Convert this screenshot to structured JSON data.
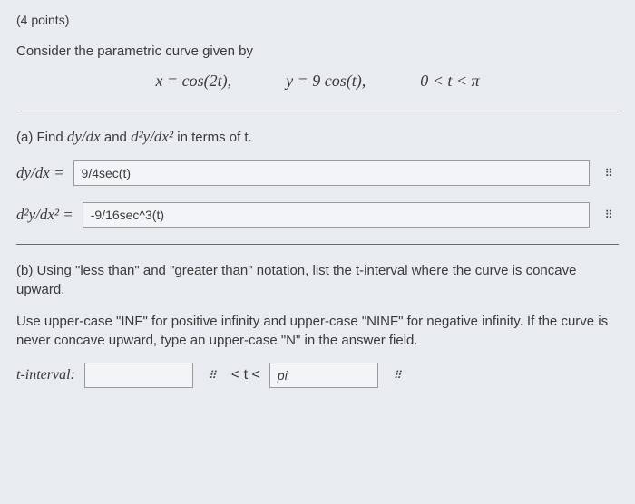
{
  "points": "(4 points)",
  "intro": "Consider the parametric curve given by",
  "eq": {
    "x": "x = cos(2t),",
    "y": "y = 9 cos(t),",
    "range": "0 < t < π"
  },
  "partA": {
    "prompt_prefix": "(a) Find ",
    "expr1": "dy/dx",
    "mid": " and ",
    "expr2": "d²y/dx²",
    "suffix": " in terms of t.",
    "label1": "dy/dx = ",
    "value1": "9/4sec(t)",
    "label2": "d²y/dx² = ",
    "value2": "-9/16sec^3(t)"
  },
  "partB": {
    "line1": "(b) Using \"less than\" and \"greater than\" notation, list the t-interval where the curve is concave upward.",
    "line2": "Use upper-case \"INF\" for positive infinity and upper-case \"NINF\" for negative infinity. If the curve is never concave upward, type an upper-case \"N\" in the answer field.",
    "label": "t-interval:",
    "lower": "",
    "mid": " < t < ",
    "upper": "pi"
  },
  "icons": {
    "grid": "⠿"
  }
}
